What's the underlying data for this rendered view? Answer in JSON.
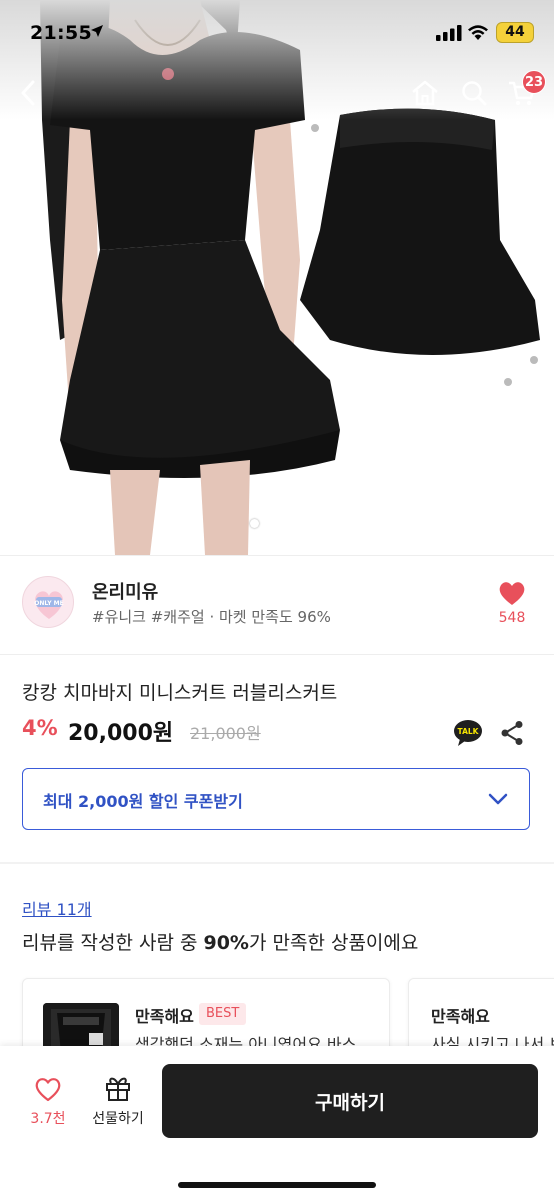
{
  "status_bar": {
    "time": "21:55",
    "battery": "44"
  },
  "nav": {
    "back_icon": "chevron-left-icon",
    "home_icon": "home-icon",
    "search_icon": "search-icon",
    "cart_icon": "cart-icon",
    "cart_count": "23"
  },
  "hero": {
    "image_index": 1
  },
  "seller": {
    "name": "온리미유",
    "tags": "#유니크 #캐주얼 · 마켓 만족도 96%",
    "like_count": "548"
  },
  "product": {
    "title": "캉캉 치마바지 미니스커트 러블리스커트",
    "discount": "4%",
    "price": "20,000원",
    "original_price": "21,000원"
  },
  "coupon": {
    "label": "최대 2,000원 할인 쿠폰받기"
  },
  "reviews": {
    "link_label": "리뷰 11개",
    "summary_prefix": "리뷰를 작성한 사람 중 ",
    "summary_percent": "90%",
    "summary_suffix": "가 만족한 상품이에요",
    "cards": [
      {
        "title": "만족해요",
        "badge": "BEST",
        "text": "생각했던 소재는 아니였어요 바스"
      },
      {
        "title": "만족해요",
        "text": "사실 시키고 나서 보"
      }
    ]
  },
  "bottom_bar": {
    "wish_count": "3.7천",
    "gift_label": "선물하기",
    "buy_label": "구매하기"
  },
  "colors": {
    "accent_red": "#e8505b",
    "link_blue": "#3052c4",
    "buy_button": "#1f1f1f"
  }
}
